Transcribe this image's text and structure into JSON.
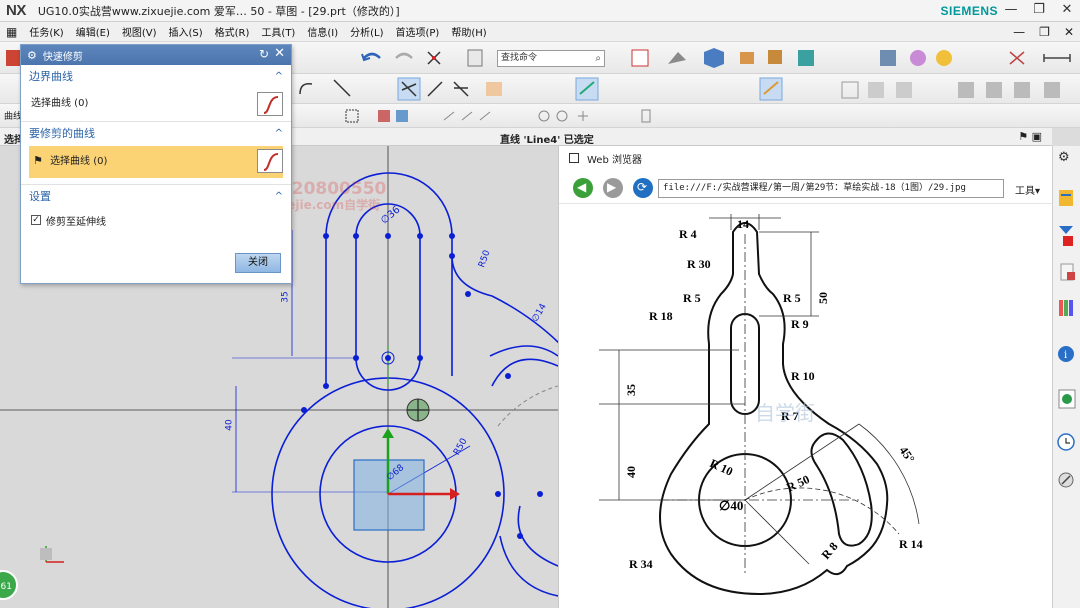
{
  "window": {
    "logo": "NX",
    "title": "UG10.0实战营www.zixuejie.com 爱军… 50 - 草图 - [29.prt（修改的）]",
    "brand": "SIEMENS",
    "controls": [
      "—",
      "❐",
      "✕"
    ]
  },
  "menubar": {
    "icon": "app-menu-icon",
    "items": [
      "任务(K)",
      "编辑(E)",
      "视图(V)",
      "插入(S)",
      "格式(R)",
      "工具(T)",
      "信息(I)",
      "分析(L)",
      "首选项(P)",
      "帮助(H)"
    ],
    "right_controls": [
      "—",
      "❐",
      "✕"
    ]
  },
  "toolbar": {
    "search_placeholder": "查找命令",
    "left_cut_label": "曲线"
  },
  "status": {
    "left": "选择",
    "center": "直线 'Line4' 已选定"
  },
  "dialog": {
    "title": "快速修剪",
    "sections": {
      "boundary": {
        "heading": "边界曲线",
        "row_label": "选择曲线 (0)"
      },
      "trim": {
        "heading": "要修剪的曲线",
        "row_label": "选择曲线 (0)"
      },
      "settings": {
        "heading": "设置",
        "option_label": "修剪至延伸线",
        "option_checked": "✓"
      }
    },
    "close_label": "关闭"
  },
  "watermark": {
    "line1": "爱军QQ/微信:120800550",
    "line2": "学习网址:www.zixuejie.com自学街"
  },
  "sketch_labels": {
    "d36": "∅36",
    "r50": "R50",
    "d14": "∅14",
    "dim35": "35",
    "dim40": "40",
    "d68": "∅68",
    "r50b": "R50"
  },
  "badge": "61",
  "browser": {
    "title": "Web 浏览器",
    "url": "file:///F:/实战营课程/第一周/第29节：草绘实战-18（1图）/29.jpg",
    "tools_label": "工具▾"
  },
  "drawing_labels": {
    "r4": "R 4",
    "w14": "14",
    "r30": "R 30",
    "r5a": "R 5",
    "r5b": "R 5",
    "r18": "R 18",
    "r9": "R 9",
    "h50": "50",
    "r10a": "R 10",
    "h35": "35",
    "r7": "R 7",
    "r10b": "R 10",
    "h40": "40",
    "d40": "∅40",
    "r50": "R 50",
    "a45": "45°",
    "r8": "R 8",
    "r14": "R 14",
    "r34": "R 34",
    "wm": "自学街"
  },
  "colors": {
    "sketch_blue": "#0a1ed6",
    "dialog_header": "#4c75ad",
    "active_row": "#fbd274",
    "siemens": "#009999"
  }
}
